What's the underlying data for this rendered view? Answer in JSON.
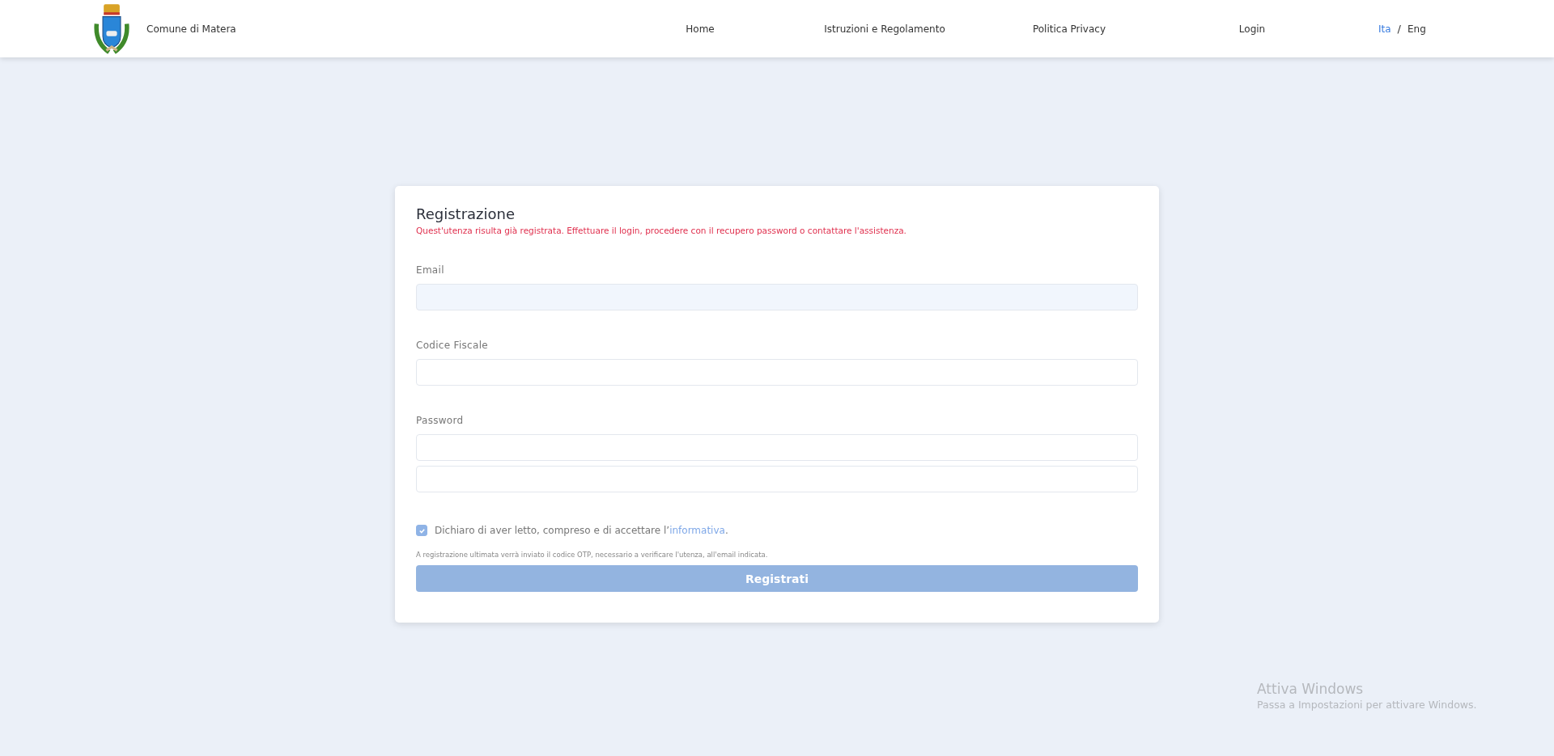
{
  "header": {
    "brand": "Comune di Matera",
    "nav": [
      "Home",
      "Istruzioni e Regolamento",
      "Politica Privacy",
      "Login"
    ],
    "languages": [
      {
        "label": "Ita",
        "selected": true
      },
      {
        "label": "Eng",
        "selected": false
      }
    ],
    "language_separator": "/"
  },
  "form": {
    "title": "Registrazione",
    "error": "Quest'utenza risulta già registrata. Effettuare il login, procedere con il recupero password o contattare l'assistenza.",
    "fields": [
      {
        "label": "Email",
        "inputs": [
          {
            "autofilled": true
          }
        ]
      },
      {
        "label": "Codice Fiscale",
        "inputs": [
          {
            "autofilled": false
          }
        ]
      },
      {
        "label": "Password",
        "inputs": [
          {
            "autofilled": false
          },
          {
            "autofilled": false
          }
        ]
      }
    ],
    "consent": {
      "checked": true,
      "prefix": "Dichiaro di aver letto, compreso e di accettare l’",
      "link": "informativa",
      "suffix": "."
    },
    "note": "A registrazione ultimata verrà inviato il codice OTP, necessario a verificare l'utenza, all'email indicata.",
    "submit": {
      "label": "Registrati",
      "disabled": true
    }
  },
  "os_notice": {
    "title": "Attiva Windows",
    "subtitle": "Passa a Impostazioni per attivare Windows."
  }
}
